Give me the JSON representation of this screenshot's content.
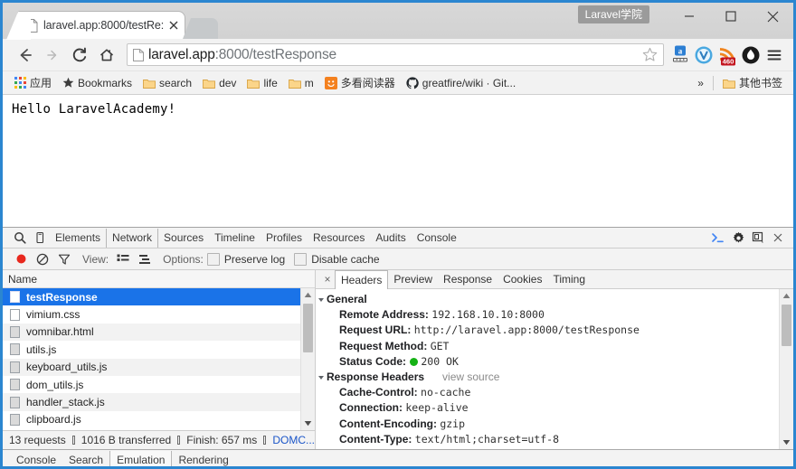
{
  "window": {
    "profile_label": "Laravel学院",
    "minimize": "minimize-button",
    "maximize": "maximize-button",
    "close": "close-button"
  },
  "tab": {
    "title": "laravel.app:8000/testRe:",
    "favicon": "page-icon",
    "close": "×"
  },
  "nav": {
    "back": "back-icon",
    "forward": "forward-icon",
    "reload": "reload-icon",
    "home": "home-icon",
    "url_host": "laravel.app",
    "url_path": ":8000/testResponse",
    "url_full": "laravel.app:8000/testResponse",
    "bookmark_star": "star-icon",
    "menu": "menu-icon",
    "extensions": [
      {
        "name": "adblock-ruler-icon",
        "badge": "a"
      },
      {
        "name": "v-circle-icon",
        "badge": ""
      },
      {
        "name": "rss-feed-icon",
        "badge": "460"
      },
      {
        "name": "flame-droplet-icon",
        "badge": ""
      }
    ]
  },
  "bookmarks": {
    "apps_label": "应用",
    "items": [
      {
        "icon": "star-icon",
        "label": "Bookmarks"
      },
      {
        "icon": "folder-icon",
        "label": "search"
      },
      {
        "icon": "folder-icon",
        "label": "dev"
      },
      {
        "icon": "folder-icon",
        "label": "life"
      },
      {
        "icon": "folder-icon",
        "label": "m"
      },
      {
        "icon": "smiley-icon",
        "label": "多看阅读器"
      },
      {
        "icon": "github-icon",
        "label": "greatfire/wiki · Git..."
      }
    ],
    "overflow": "»",
    "other_label": "其他书签"
  },
  "page": {
    "content": "Hello LaravelAcademy!"
  },
  "devtools": {
    "tabs": [
      {
        "label": "Elements",
        "active": false
      },
      {
        "label": "Network",
        "active": true
      },
      {
        "label": "Sources",
        "active": false
      },
      {
        "label": "Timeline",
        "active": false
      },
      {
        "label": "Profiles",
        "active": false
      },
      {
        "label": "Resources",
        "active": false
      },
      {
        "label": "Audits",
        "active": false
      },
      {
        "label": "Console",
        "active": false
      }
    ],
    "left_icons": [
      "search-icon",
      "device-toggle-icon"
    ],
    "right_icons": [
      "console-prompt-icon",
      "gear-icon",
      "dock-side-icon",
      "close-icon"
    ],
    "subbar": {
      "record": "record-icon",
      "clear": "clear-icon",
      "filter": "filter-icon",
      "view_label": "View:",
      "view_list": "list-view-icon",
      "view_timeline": "timeline-view-icon",
      "options_label": "Options:",
      "preserve_log": "Preserve log",
      "disable_cache": "Disable cache"
    },
    "requests": {
      "column_header": "Name",
      "rows": [
        {
          "name": "testResponse",
          "icon": "document-icon",
          "selected": true
        },
        {
          "name": "vimium.css",
          "icon": "stylesheet-icon",
          "selected": false
        },
        {
          "name": "vomnibar.html",
          "icon": "document-icon",
          "selected": false
        },
        {
          "name": "utils.js",
          "icon": "script-icon",
          "selected": false
        },
        {
          "name": "keyboard_utils.js",
          "icon": "script-icon",
          "selected": false
        },
        {
          "name": "dom_utils.js",
          "icon": "script-icon",
          "selected": false
        },
        {
          "name": "handler_stack.js",
          "icon": "script-icon",
          "selected": false
        },
        {
          "name": "clipboard.js",
          "icon": "script-icon",
          "selected": false
        }
      ]
    },
    "status": {
      "requests": "13 requests",
      "transferred": "1016 B transferred",
      "finish": "Finish: 657 ms",
      "domcontent": "DOMC..."
    },
    "detail_tabs": [
      {
        "label": "Headers",
        "active": true
      },
      {
        "label": "Preview",
        "active": false
      },
      {
        "label": "Response",
        "active": false
      },
      {
        "label": "Cookies",
        "active": false
      },
      {
        "label": "Timing",
        "active": false
      }
    ],
    "headers": {
      "general_title": "General",
      "general": [
        {
          "key": "Remote Address:",
          "value": "192.168.10.10:8000"
        },
        {
          "key": "Request URL:",
          "value": "http://laravel.app:8000/testResponse"
        },
        {
          "key": "Request Method:",
          "value": "GET"
        },
        {
          "key": "Status Code:",
          "value": "200 OK",
          "status_dot": true
        }
      ],
      "response_title": "Response Headers",
      "view_source": "view source",
      "response": [
        {
          "key": "Cache-Control:",
          "value": "no-cache"
        },
        {
          "key": "Connection:",
          "value": "keep-alive"
        },
        {
          "key": "Content-Encoding:",
          "value": "gzip"
        },
        {
          "key": "Content-Type:",
          "value": "text/html;charset=utf-8"
        }
      ]
    },
    "drawer_tabs": [
      {
        "label": "Console",
        "active": false
      },
      {
        "label": "Search",
        "active": false
      },
      {
        "label": "Emulation",
        "active": true
      },
      {
        "label": "Rendering",
        "active": false
      }
    ]
  },
  "colors": {
    "window_border": "#2b86d0",
    "selection": "#1a73e8",
    "link": "#1a55c8",
    "status_green": "#15b215",
    "rss_badge": "#c3141e"
  }
}
